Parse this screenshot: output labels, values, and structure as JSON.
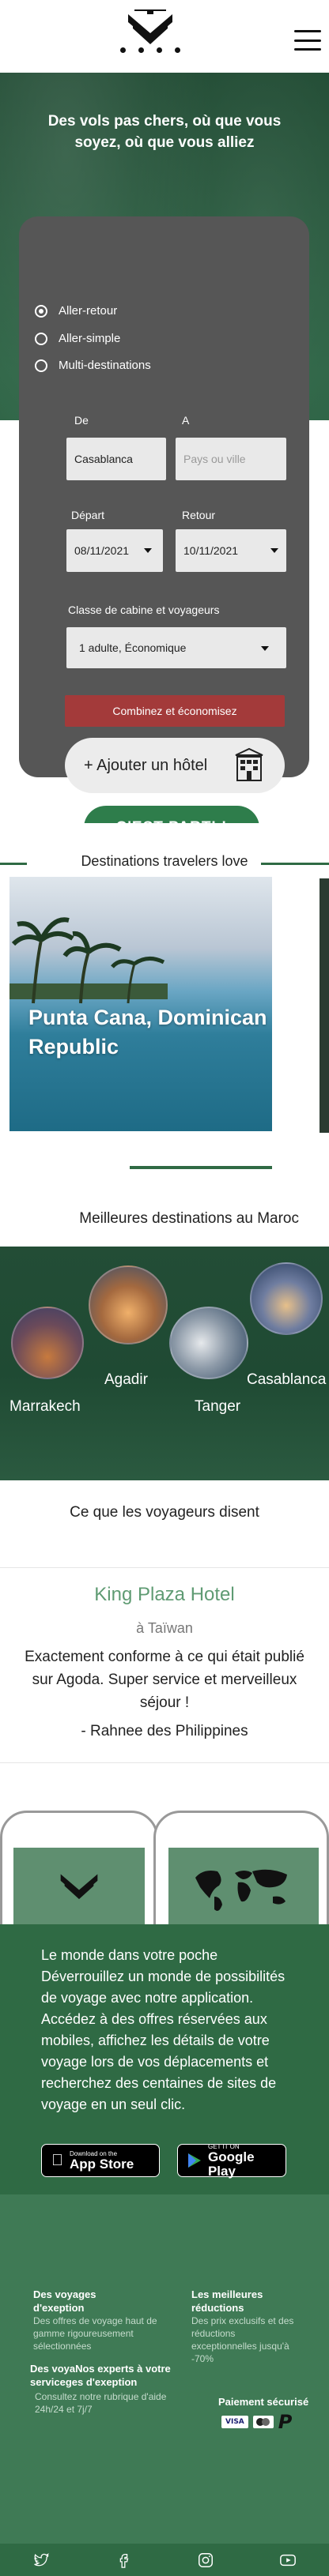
{
  "header": {
    "logo_icon": "chevron-emblem-icon",
    "menu_icon": "hamburger-menu-icon"
  },
  "hero": {
    "title": "Des vols pas chers, où que vous soyez, où que vous alliez"
  },
  "search": {
    "trip_types": [
      {
        "label": "Aller-retour",
        "checked": true
      },
      {
        "label": "Aller-simple",
        "checked": false
      },
      {
        "label": "Multi-destinations",
        "checked": false
      }
    ],
    "from_label": "De",
    "to_label": "A",
    "from_value": "Casablanca",
    "to_placeholder": "Pays ou ville",
    "depart_label": "Départ",
    "return_label": "Retour",
    "depart_value": "08/11/2021",
    "return_value": "10/11/2021",
    "cabin_label": "Classe de cabine et voyageurs",
    "cabin_value": "1 adulte, Économique",
    "combine_button": "Combinez et économisez",
    "hotel_button": "+ Ajouter un hôtel",
    "submit_button": "C'EST PARTI !",
    "colors": {
      "card": "#565656",
      "combine": "#a33a3a",
      "submit": "#2e7d4b"
    }
  },
  "destinations": {
    "title": "Destinations travelers love",
    "cards": [
      {
        "city": "Punta Cana, Dominican Republic"
      }
    ]
  },
  "maroc": {
    "title": "Meilleures destinations au Maroc",
    "cities": [
      "Marrakech",
      "Agadir",
      "Tanger",
      "Casablanca"
    ]
  },
  "reviews": {
    "title": "Ce que les voyageurs disent",
    "hotel": "King Plaza Hotel",
    "location": "à Taïwan",
    "text": "Exactement conforme à ce qui était publié sur Agoda. Super service et merveilleux séjour !",
    "author": "- Rahnee des Philippines"
  },
  "app_promo": {
    "text": "Le monde dans votre poche Déverrouillez un monde de possibilités de voyage avec notre application. Accédez à des offres réservées aux mobiles, affichez les détails de votre voyage lors de vos déplacements et recherchez des centaines de sites de voyage en un seul clic.",
    "app_store_small": "Download on the",
    "app_store_big": "App Store",
    "google_small": "GET IT ON",
    "google_big": "Google Play"
  },
  "footer": {
    "col1_head": "Des voyages d'exeption",
    "col1_sub": "Des offres de voyage haut de gamme rigoureusement sélectionnées",
    "col2_head": "Les meilleures réductions",
    "col2_sub": "Des prix exclusifs et des réductions exceptionnelles jusqu'à -70%",
    "col3_head": "Des voyaNos experts à votre serviceges d'exeption",
    "col3_sub": "Consultez notre rubrique d'aide 24h/24 et 7j/7",
    "payment_head": "Paiement sécurisé",
    "payment_icons": [
      "visa-icon",
      "mastercard-icon",
      "paypal-icon"
    ],
    "social_icons": [
      "twitter-icon",
      "facebook-icon",
      "instagram-icon",
      "youtube-icon"
    ]
  }
}
